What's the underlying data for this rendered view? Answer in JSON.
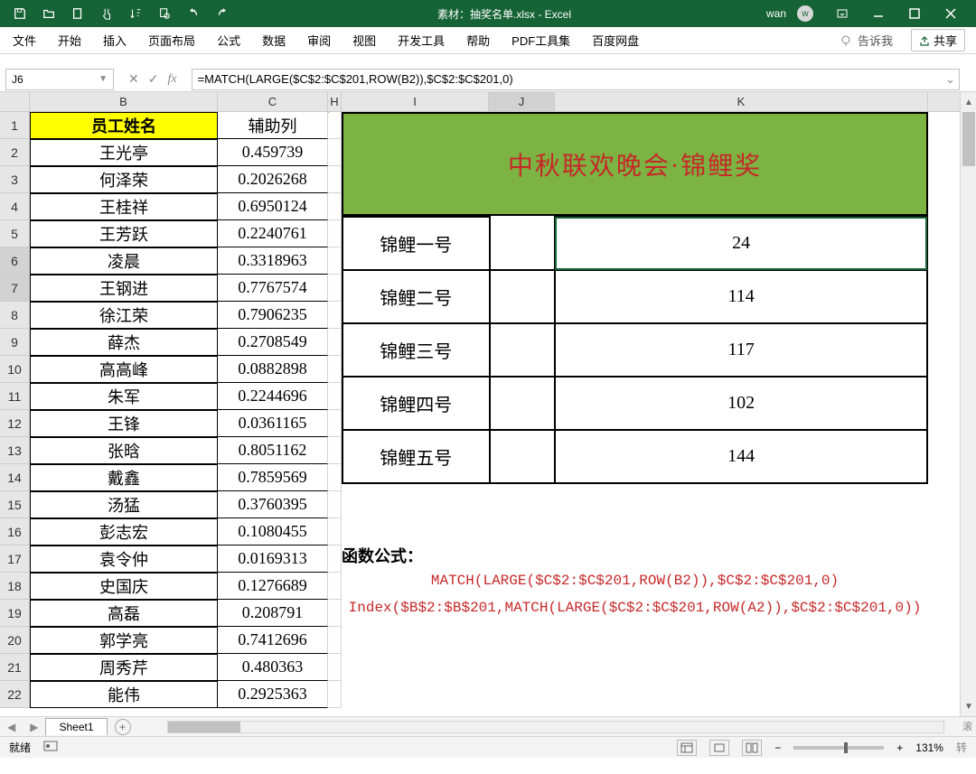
{
  "title": "素材：抽奖名单.xlsx - Excel",
  "user": "wan",
  "avatar_letter": "w",
  "ribbon_tabs": [
    "文件",
    "开始",
    "插入",
    "页面布局",
    "公式",
    "数据",
    "审阅",
    "视图",
    "开发工具",
    "帮助",
    "PDF工具集",
    "百度网盘"
  ],
  "tell_me": "告诉我",
  "share": "共享",
  "name_box": "J6",
  "formula": "=MATCH(LARGE($C$2:$C$201,ROW(B2)),$C$2:$C$201,0)",
  "col_headers": {
    "B": "B",
    "C": "C",
    "H": "H",
    "I": "I",
    "J": "J",
    "K": "K"
  },
  "col_widths": {
    "B": 208,
    "C": 122,
    "H": 15,
    "I": 163,
    "J": 73,
    "K": 413
  },
  "header_row": {
    "B": "员工姓名",
    "C": "辅助列"
  },
  "rows": [
    {
      "n": 2,
      "b": "王光亭",
      "c": "0.459739"
    },
    {
      "n": 3,
      "b": "何泽荣",
      "c": "0.2026268"
    },
    {
      "n": 4,
      "b": "王桂祥",
      "c": "0.6950124"
    },
    {
      "n": 5,
      "b": "王芳跃",
      "c": "0.2240761"
    },
    {
      "n": 6,
      "b": "凌晨",
      "c": "0.3318963"
    },
    {
      "n": 7,
      "b": "王钢进",
      "c": "0.7767574"
    },
    {
      "n": 8,
      "b": "徐江荣",
      "c": "0.7906235"
    },
    {
      "n": 9,
      "b": "薛杰",
      "c": "0.2708549"
    },
    {
      "n": 10,
      "b": "高高峰",
      "c": "0.0882898"
    },
    {
      "n": 11,
      "b": "朱军",
      "c": "0.2244696"
    },
    {
      "n": 12,
      "b": "王锋",
      "c": "0.0361165"
    },
    {
      "n": 13,
      "b": "张晗",
      "c": "0.8051162"
    },
    {
      "n": 14,
      "b": "戴鑫",
      "c": "0.7859569"
    },
    {
      "n": 15,
      "b": "汤猛",
      "c": "0.3760395"
    },
    {
      "n": 16,
      "b": "彭志宏",
      "c": "0.1080455"
    },
    {
      "n": 17,
      "b": "袁令仲",
      "c": "0.0169313"
    },
    {
      "n": 18,
      "b": "史国庆",
      "c": "0.1276689"
    },
    {
      "n": 19,
      "b": "高磊",
      "c": "0.208791"
    },
    {
      "n": 20,
      "b": "郭学亮",
      "c": "0.7412696"
    },
    {
      "n": 21,
      "b": "周秀芹",
      "c": "0.480363"
    },
    {
      "n": 22,
      "b": "能伟",
      "c": "0.2925363"
    }
  ],
  "banner": "中秋联欢晚会·锦鲤奖",
  "prizes": [
    {
      "label": "锦鲤一号",
      "val": "24"
    },
    {
      "label": "锦鲤二号",
      "val": "114"
    },
    {
      "label": "锦鲤三号",
      "val": "117"
    },
    {
      "label": "锦鲤四号",
      "val": "102"
    },
    {
      "label": "锦鲤五号",
      "val": "144"
    }
  ],
  "formula_title": "函数公式：",
  "formula_line1": "MATCH(LARGE($C$2:$C$201,ROW(B2)),$C$2:$C$201,0)",
  "formula_line2": "Index($B$2:$B$201,MATCH(LARGE($C$2:$C$201,ROW(A2)),$C$2:$C$201,0))",
  "sheet_tab": "Sheet1",
  "status_ready": "就绪",
  "zoom": "131%",
  "zoom_side": "转",
  "scroll_side": "滚"
}
